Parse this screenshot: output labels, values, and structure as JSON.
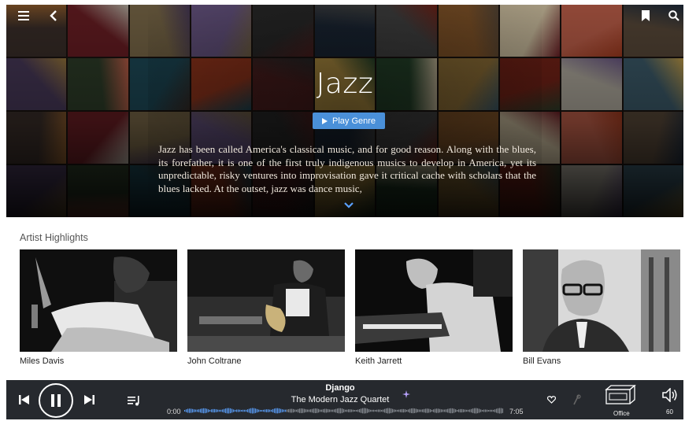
{
  "hero": {
    "genre": "Jazz",
    "play_label": "Play Genre",
    "description": "Jazz has been called America's classical music, and for good reason. Along with the blues, its forefather, it is one of the first truly indigenous musics to develop in America, yet its unpredictable, risky ventures into improvisation gave it critical cache with scholars that the blues lacked. At the outset, jazz was dance music,",
    "icons": [
      "menu-icon",
      "back-icon",
      "bookmark-icon",
      "search-icon",
      "chevron-down-icon"
    ]
  },
  "artist_highlights": {
    "title": "Artist Highlights",
    "artists": [
      {
        "name": "Miles Davis"
      },
      {
        "name": "John Coltrane"
      },
      {
        "name": "Keith Jarrett"
      },
      {
        "name": "Bill Evans"
      }
    ]
  },
  "player": {
    "track": "Django",
    "artist": "The Modern Jazz Quartet",
    "elapsed": "0:00",
    "duration": "7:05",
    "progress": 0.0,
    "zone": "Office",
    "volume": "60",
    "colors": {
      "bar": "#26292e",
      "accent": "#4a90d9"
    }
  }
}
